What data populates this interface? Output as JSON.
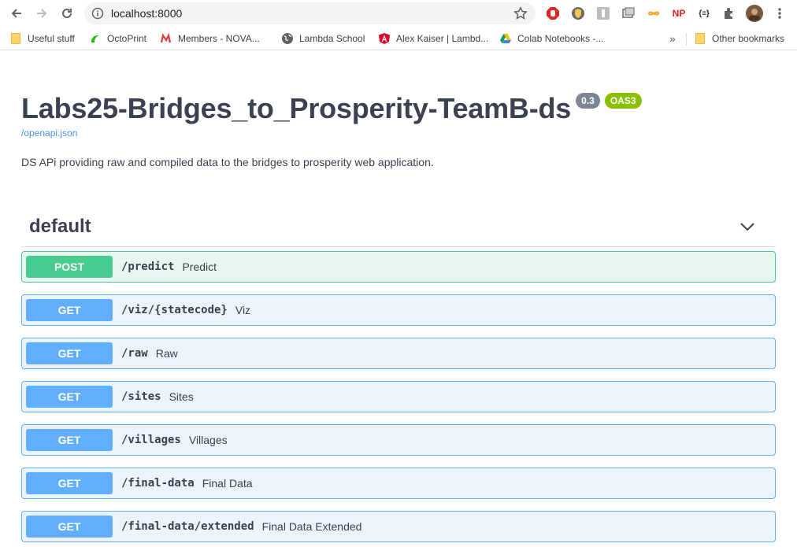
{
  "browser": {
    "url": "localhost:8000",
    "bookmarks": [
      {
        "label": "Useful stuff",
        "icon": "folder-icon"
      },
      {
        "label": "OctoPrint",
        "icon": "octoprint-icon"
      },
      {
        "label": "Members - NOVA...",
        "icon": "meetup-icon"
      },
      {
        "label": "Lambda School",
        "icon": "globe-icon"
      },
      {
        "label": "Alex Kaiser | Lambd...",
        "icon": "angular-icon"
      },
      {
        "label": "Colab Notebooks -...",
        "icon": "google-drive-icon"
      }
    ],
    "overflow": "»",
    "other_bookmarks": "Other bookmarks"
  },
  "api": {
    "title": "Labs25-Bridges_to_Prosperity-TeamB-ds",
    "version": "0.3",
    "oas": "OAS3",
    "spec_link": "/openapi.json",
    "description": "DS APi providing raw and compiled data to the bridges to prosperity web application."
  },
  "tag": {
    "name": "default"
  },
  "operations": [
    {
      "method": "POST",
      "path": "/predict",
      "summary": "Predict"
    },
    {
      "method": "GET",
      "path": "/viz/{statecode}",
      "summary": "Viz"
    },
    {
      "method": "GET",
      "path": "/raw",
      "summary": "Raw"
    },
    {
      "method": "GET",
      "path": "/sites",
      "summary": "Sites"
    },
    {
      "method": "GET",
      "path": "/villages",
      "summary": "Villages"
    },
    {
      "method": "GET",
      "path": "/final-data",
      "summary": "Final Data"
    },
    {
      "method": "GET",
      "path": "/final-data/extended",
      "summary": "Final Data Extended"
    }
  ],
  "colors": {
    "get": "#61affe",
    "post": "#49cc90",
    "text": "#3b4151",
    "link": "#4990e2"
  }
}
